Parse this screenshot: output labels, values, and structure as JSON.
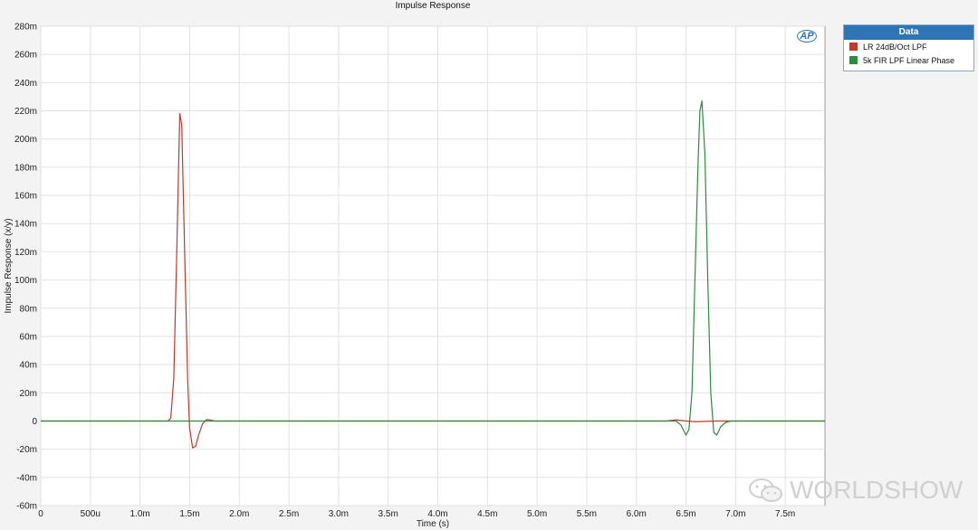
{
  "chart_data": {
    "type": "line",
    "title": "Impulse Response",
    "xlabel": "Time (s)",
    "ylabel": "Impulse Response (x/y)",
    "xlim": [
      0,
      0.0079
    ],
    "ylim": [
      -0.06,
      0.28
    ],
    "x_ticks": [
      0,
      0.0005,
      0.001,
      0.0015,
      0.002,
      0.0025,
      0.003,
      0.0035,
      0.004,
      0.0045,
      0.005,
      0.0055,
      0.006,
      0.0065,
      0.007,
      0.0075
    ],
    "x_tick_labels": [
      "0",
      "500u",
      "1.0m",
      "1.5m",
      "2.0m",
      "2.5m",
      "3.0m",
      "3.5m",
      "4.0m",
      "4.5m",
      "5.0m",
      "5.5m",
      "6.0m",
      "6.5m",
      "7.0m",
      "7.5m"
    ],
    "y_ticks": [
      -0.06,
      -0.04,
      -0.02,
      0,
      0.02,
      0.04,
      0.06,
      0.08,
      0.1,
      0.12,
      0.14,
      0.16,
      0.18,
      0.2,
      0.22,
      0.24,
      0.26,
      0.28
    ],
    "y_tick_labels": [
      "-60m",
      "-40m",
      "-20m",
      "0",
      "20m",
      "40m",
      "60m",
      "80m",
      "100m",
      "120m",
      "140m",
      "160m",
      "180m",
      "200m",
      "220m",
      "240m",
      "260m",
      "280m"
    ],
    "grid": true,
    "legend_position": "outside-right-top",
    "series": [
      {
        "name": "LR 24dB/Oct LPF",
        "color": "#c0392b",
        "points": [
          [
            0,
            0
          ],
          [
            0.00128,
            0
          ],
          [
            0.00131,
            0.002
          ],
          [
            0.00134,
            0.03
          ],
          [
            0.00137,
            0.12
          ],
          [
            0.0014,
            0.218
          ],
          [
            0.00142,
            0.21
          ],
          [
            0.00145,
            0.12
          ],
          [
            0.00148,
            0.03
          ],
          [
            0.0015,
            -0.005
          ],
          [
            0.00153,
            -0.019
          ],
          [
            0.00156,
            -0.018
          ],
          [
            0.00159,
            -0.01
          ],
          [
            0.00163,
            -0.002
          ],
          [
            0.00167,
            0.001
          ],
          [
            0.0017,
            0.0008
          ],
          [
            0.00175,
            0
          ],
          [
            0.0063,
            0
          ],
          [
            0.0064,
            0.0008
          ],
          [
            0.0065,
            0
          ],
          [
            0.0066,
            -0.0005
          ],
          [
            0.0068,
            0
          ],
          [
            0.0079,
            0
          ]
        ]
      },
      {
        "name": "5k FIR LPF Linear Phase",
        "color": "#2e8b3e",
        "points": [
          [
            0,
            0
          ],
          [
            0.0064,
            0
          ],
          [
            0.00645,
            -0.003
          ],
          [
            0.0065,
            -0.01
          ],
          [
            0.00653,
            -0.006
          ],
          [
            0.00656,
            0.02
          ],
          [
            0.00659,
            0.1
          ],
          [
            0.00662,
            0.18
          ],
          [
            0.00664,
            0.22
          ],
          [
            0.00666,
            0.227
          ],
          [
            0.00669,
            0.19
          ],
          [
            0.00672,
            0.1
          ],
          [
            0.00675,
            0.02
          ],
          [
            0.00678,
            -0.008
          ],
          [
            0.00681,
            -0.01
          ],
          [
            0.00685,
            -0.004
          ],
          [
            0.0069,
            -0.001
          ],
          [
            0.00695,
            0
          ],
          [
            0.0079,
            0
          ]
        ]
      }
    ]
  },
  "legend": {
    "header": "Data"
  },
  "logo": {
    "text": "AP"
  },
  "watermark": {
    "text": "WORLDSHOW"
  }
}
